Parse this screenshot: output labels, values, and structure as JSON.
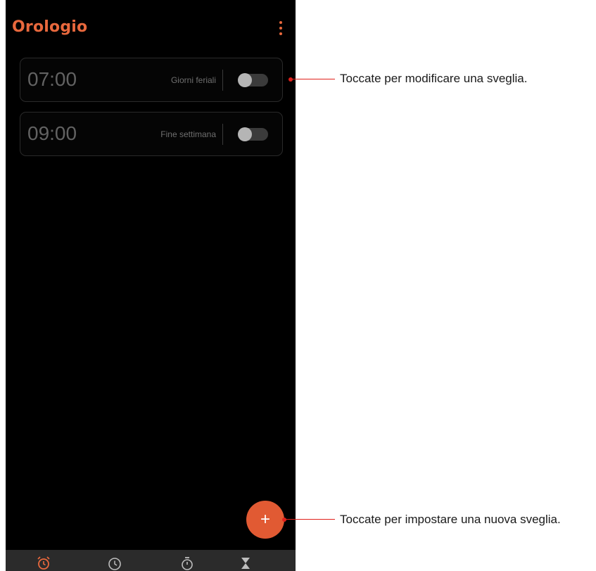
{
  "app": {
    "title": "Orologio"
  },
  "alarms": [
    {
      "time": "07:00",
      "label": "Giorni feriali",
      "enabled": false
    },
    {
      "time": "09:00",
      "label": "Fine settimana",
      "enabled": false
    }
  ],
  "fab": {
    "label": "+"
  },
  "bottom_nav": {
    "items": [
      {
        "icon": "alarm-clock-icon",
        "active": true
      },
      {
        "icon": "world-clock-icon",
        "active": false
      },
      {
        "icon": "stopwatch-icon",
        "active": false
      },
      {
        "icon": "timer-hourglass-icon",
        "active": false
      }
    ]
  },
  "annotations": {
    "edit_alarm": "Toccate per modificare una sveglia.",
    "new_alarm": "Toccate per impostare una nuova sveglia."
  },
  "colors": {
    "accent": "#e8683d",
    "fab": "#e15a33",
    "background": "#000000",
    "callout": "#e0201a"
  }
}
